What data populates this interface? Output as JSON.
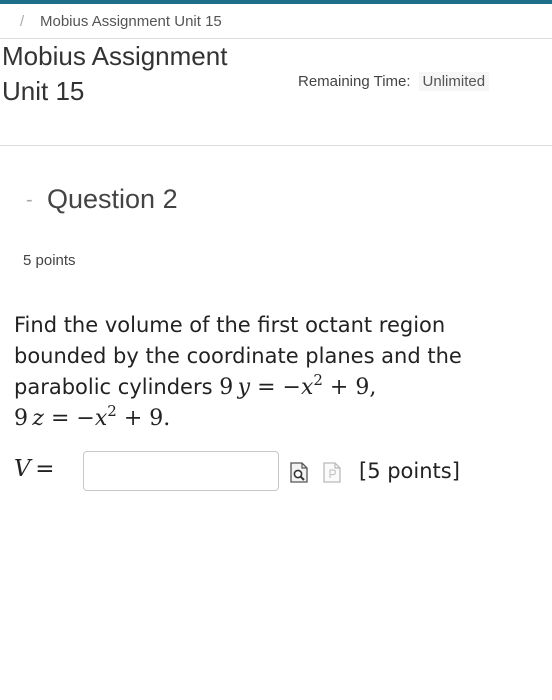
{
  "breadcrumb": {
    "separator": "/",
    "current": "Mobius Assignment Unit 15"
  },
  "header": {
    "title": "Mobius Assignment Unit 15",
    "remaining_label": "Remaining Time:",
    "remaining_value": "Unlimited"
  },
  "question": {
    "toggle": "-",
    "title": "Question 2",
    "points": "5 points",
    "text_intro": "Find the volume of the first octant region bounded by the coordinate planes and the parabolic cylinders",
    "eq1": {
      "lhs": "9",
      "var": "y",
      "rel": "= −",
      "x": "x",
      "exp": "2",
      "rest": "+ 9,"
    },
    "eq2": {
      "lhs": "9",
      "var": "z",
      "rel": "= −",
      "x": "x",
      "exp": "2",
      "rest": "+ 9."
    },
    "answer": {
      "label_var": "V",
      "label_eq": "=",
      "value": "",
      "preview_icon": "preview-magnifier-icon",
      "plain_icon": "document-icon",
      "points_note": "[5 points]"
    }
  },
  "colors": {
    "accent": "#1f6f8b",
    "border": "#dcdcdc"
  }
}
